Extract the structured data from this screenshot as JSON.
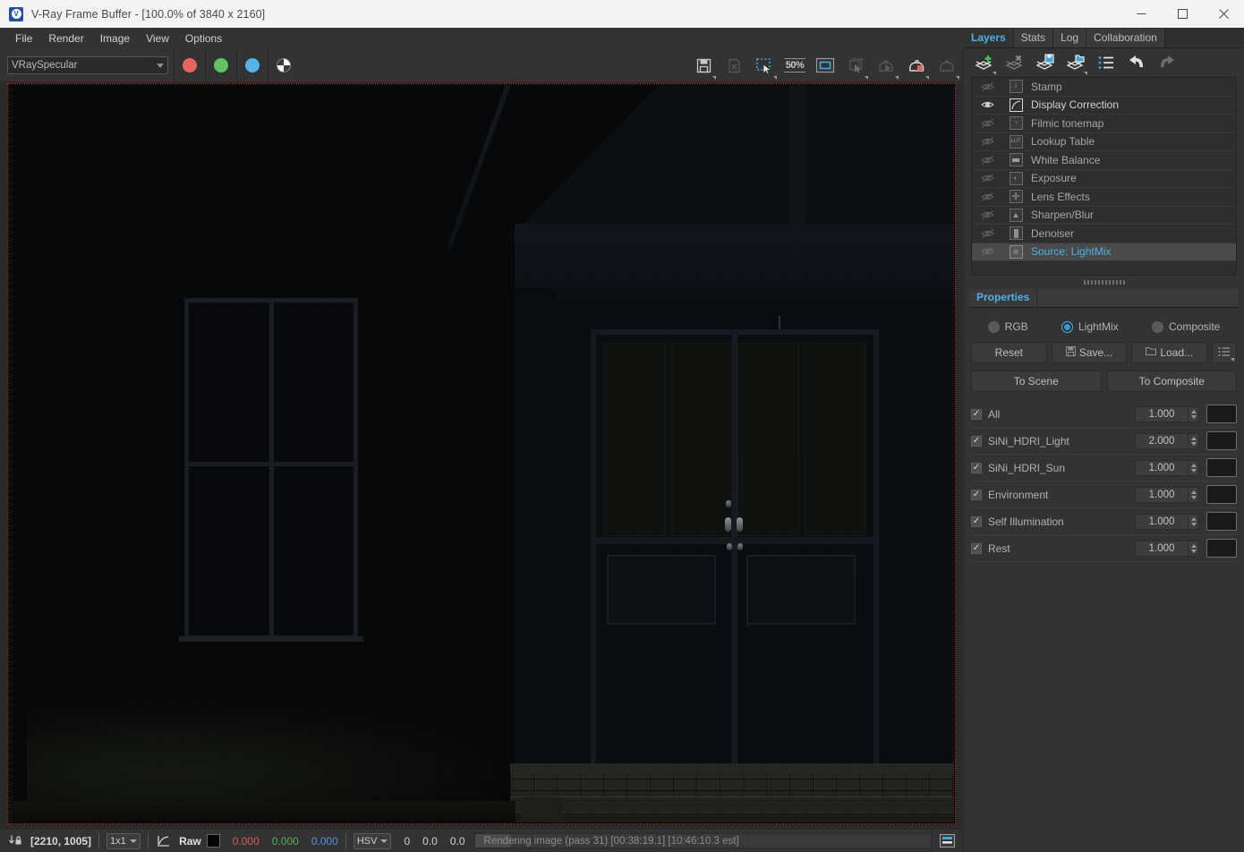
{
  "window": {
    "title": "V-Ray Frame Buffer - [100.0% of 3840 x 2160]",
    "app_icon": "vray-logo-icon",
    "minimize_label": "–",
    "maximize_label": "□",
    "close_label": "×"
  },
  "menubar": {
    "items": [
      {
        "label": "File"
      },
      {
        "label": "Render"
      },
      {
        "label": "Image"
      },
      {
        "label": "View"
      },
      {
        "label": "Options"
      }
    ]
  },
  "toolbar": {
    "channel_select": {
      "value": "VRaySpecular"
    },
    "channel_buttons": [
      {
        "name": "red-channel-button",
        "color": "#e8655f"
      },
      {
        "name": "green-channel-button",
        "color": "#5fc45f"
      },
      {
        "name": "blue-channel-button",
        "color": "#52b4ea"
      },
      {
        "name": "alpha-channel-button",
        "color": "#ffffff"
      }
    ],
    "right_buttons": [
      {
        "name": "save-image-button",
        "icon": "save-icon",
        "enabled": true
      },
      {
        "name": "clear-image-button",
        "icon": "clear-image-icon",
        "enabled": false
      },
      {
        "name": "region-render-button",
        "icon": "marquee-select-icon",
        "enabled": true
      },
      {
        "name": "zoom-level-button",
        "icon": "50%",
        "enabled": true
      },
      {
        "name": "fit-view-button",
        "icon": "fit-rect-icon",
        "enabled": true
      },
      {
        "name": "pick-object-button",
        "icon": "cube-pointer-icon",
        "enabled": false
      },
      {
        "name": "render-last-button",
        "icon": "teapot-play-icon",
        "enabled": false
      },
      {
        "name": "render-stop-button",
        "icon": "teapot-stop-icon",
        "enabled": true
      },
      {
        "name": "render-button",
        "icon": "teapot-icon",
        "enabled": false
      }
    ],
    "zoom_label": "50%"
  },
  "render_view": {
    "region_marker": "#cc2222"
  },
  "right_panel": {
    "tabs": [
      {
        "label": "Layers",
        "selected": true
      },
      {
        "label": "Stats",
        "selected": false
      },
      {
        "label": "Log",
        "selected": false
      },
      {
        "label": "Collaboration",
        "selected": false
      }
    ],
    "layer_toolbar": [
      {
        "name": "add-layer-button",
        "icon": "layer-add-icon"
      },
      {
        "name": "delete-layer-button",
        "icon": "layer-delete-icon"
      },
      {
        "name": "save-layers-button",
        "icon": "layer-save-icon"
      },
      {
        "name": "load-layers-button",
        "icon": "layer-load-icon"
      },
      {
        "name": "layer-presets-button",
        "icon": "list-icon"
      },
      {
        "name": "undo-button",
        "icon": "undo-icon"
      },
      {
        "name": "redo-button",
        "icon": "redo-icon"
      }
    ],
    "layers": [
      {
        "name": "Stamp",
        "icon": "info-icon",
        "visible": false,
        "enabled": false,
        "selected": false
      },
      {
        "name": "Display Correction",
        "icon": "curve-icon",
        "visible": true,
        "enabled": true,
        "selected": false
      },
      {
        "name": "Filmic tonemap",
        "icon": "filmic-icon",
        "visible": false,
        "enabled": false,
        "selected": false
      },
      {
        "name": "Lookup Table",
        "icon": "lut-icon",
        "visible": false,
        "enabled": false,
        "selected": false
      },
      {
        "name": "White Balance",
        "icon": "white-balance-icon",
        "visible": false,
        "enabled": false,
        "selected": false
      },
      {
        "name": "Exposure",
        "icon": "exposure-icon",
        "visible": false,
        "enabled": false,
        "selected": false
      },
      {
        "name": "Lens Effects",
        "icon": "lens-effects-icon",
        "visible": false,
        "enabled": false,
        "selected": false
      },
      {
        "name": "Sharpen/Blur",
        "icon": "sharpen-blur-icon",
        "visible": false,
        "enabled": false,
        "selected": false
      },
      {
        "name": "Denoiser",
        "icon": "denoiser-icon",
        "visible": false,
        "enabled": false,
        "selected": false
      },
      {
        "name": "Source: LightMix",
        "icon": "source-icon",
        "visible": false,
        "enabled": false,
        "selected": true
      }
    ],
    "properties": {
      "tab_label": "Properties",
      "modes": [
        {
          "label": "RGB",
          "selected": false
        },
        {
          "label": "LightMix",
          "selected": true
        },
        {
          "label": "Composite",
          "selected": false
        }
      ],
      "buttons": [
        {
          "label": "Reset",
          "icon": null
        },
        {
          "label": "Save...",
          "icon": "save-small-icon"
        },
        {
          "label": "Load...",
          "icon": "folder-small-icon"
        },
        {
          "label": "",
          "icon": "menu-list-icon"
        }
      ],
      "action_buttons": [
        {
          "label": "To Scene"
        },
        {
          "label": "To Composite"
        }
      ],
      "lightmix": [
        {
          "label": "All",
          "checked": true,
          "value": "1.000",
          "color": "#1a1a1a"
        },
        {
          "label": "SiNi_HDRI_Light",
          "checked": true,
          "value": "2.000",
          "color": "#1a1a1a"
        },
        {
          "label": "SiNi_HDRI_Sun",
          "checked": true,
          "value": "1.000",
          "color": "#1a1a1a"
        },
        {
          "label": "Environment",
          "checked": true,
          "value": "1.000",
          "color": "#1a1a1a"
        },
        {
          "label": "Self Illumination",
          "checked": true,
          "value": "1.000",
          "color": "#1a1a1a"
        },
        {
          "label": "Rest",
          "checked": true,
          "value": "1.000",
          "color": "#1a1a1a"
        }
      ]
    }
  },
  "statusbar": {
    "pixel_lock_icon": "pixel-lock-icon",
    "coordinates": "[2210, 1005]",
    "sample_size": "1x1",
    "curve_icon": "curve-sample-icon",
    "mode_label": "Raw",
    "sample_color": "#050505",
    "values": {
      "r": "0.000",
      "g": "0.000",
      "b": "0.000"
    },
    "color_space": "HSV",
    "hsv": {
      "h": "0",
      "s": "0.0",
      "v": "0.0"
    },
    "progress_text": "Rendering image (pass 31) [00:38:19.1] [10:46:10.3 est]",
    "progress_percent": 8,
    "layout_icon": "layout-toggle-icon"
  }
}
